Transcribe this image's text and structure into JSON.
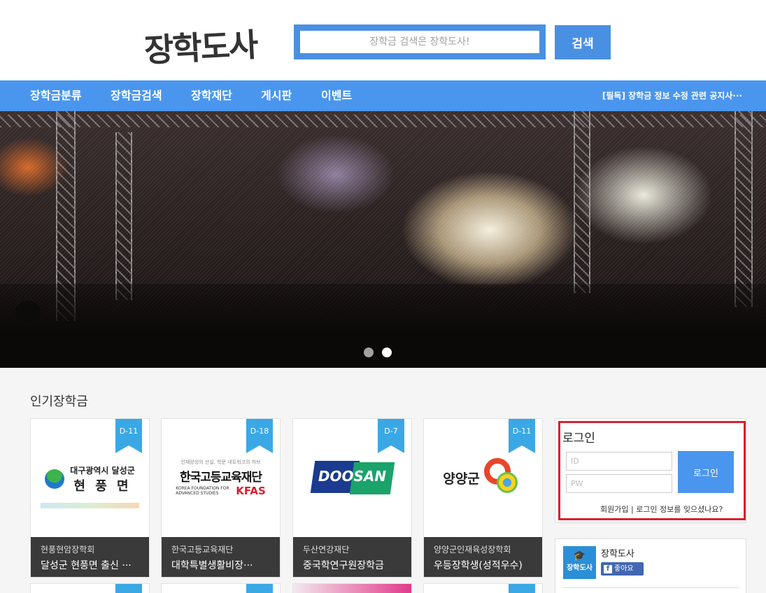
{
  "header": {
    "logo_text": "장학도사",
    "search_placeholder": "장학금 검색은 장학도사!",
    "search_button": "검색"
  },
  "nav": {
    "items": [
      "장학금분류",
      "장학금검색",
      "장학재단",
      "게시판",
      "이벤트"
    ],
    "notice": "[필독] 장학금 정보 수정 관련 공지사···"
  },
  "hero": {
    "slide_count": 2,
    "active_slide": 2
  },
  "popular": {
    "title": "인기장학금",
    "cards": [
      {
        "dday": "D-11",
        "org": "현풍현암장학회",
        "name": "달성군 현풍면 출신 ···",
        "logo_line1": "대구광역시 달성군",
        "logo_line2": "현 풍 면"
      },
      {
        "dday": "D-18",
        "org": "한국고등교육재단",
        "name": "대학특별생활비장···",
        "logo_small": "인재양성의 산실, 학문 네트워크의 허브",
        "logo_main": "한국고등교육재단",
        "logo_en": "KOREA FOUNDATION FOR ADVANCED STUDIES",
        "logo_abbr": "KFAS"
      },
      {
        "dday": "D-7",
        "org": "두산연강재단",
        "name": "중국학연구원장학금",
        "logo_text": "DOOSAN"
      },
      {
        "dday": "D-11",
        "org": "양양군인재육성장학회",
        "name": "우등장학생(성적우수)",
        "logo_text": "양양군"
      }
    ]
  },
  "login": {
    "title": "로그인",
    "id_placeholder": "ID",
    "pw_placeholder": "PW",
    "button": "로그인",
    "signup": "회원가입",
    "separator": " | ",
    "forgot": "로그인 정보를 잊으셨나요?"
  },
  "facebook": {
    "page_name": "장학도사",
    "like_label": "좋아요",
    "logo_text": "장학도사"
  },
  "colors": {
    "brand_blue": "#4a96ee",
    "ribbon_blue": "#3ba8e6",
    "highlight_red": "#d9202e",
    "card_footer": "#3a3a3a"
  }
}
